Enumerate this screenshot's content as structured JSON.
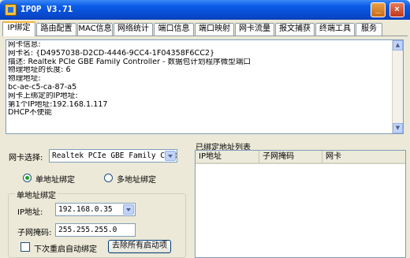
{
  "window": {
    "title": "IPOP V3.71"
  },
  "tabs": [
    {
      "label": "IP绑定"
    },
    {
      "label": "路由配置"
    },
    {
      "label": "MAC信息"
    },
    {
      "label": "网络统计"
    },
    {
      "label": "端口信息"
    },
    {
      "label": "端口映射"
    },
    {
      "label": "网卡流量"
    },
    {
      "label": "报文捕获"
    },
    {
      "label": "终端工具"
    },
    {
      "label": "服务"
    }
  ],
  "info": {
    "lines": [
      "网卡信息:",
      "网卡名: {D4957038-D2CD-4446-9CC4-1F04358F6CC2}",
      "描述: Realtek PCIe GBE Family Controller - 数据包计划程序微型端口",
      "物理地址的长度: 6",
      "物理地址:",
      "bc-ae-c5-ca-87-a5",
      "网卡上绑定的IP地址:",
      "第1个IP地址:192.168.1.117",
      "DHCP不使能"
    ]
  },
  "binding": {
    "nic_label": "网卡选择:",
    "nic_value": "Realtek PCIe GBE Family Cont",
    "mode_single": "单地址绑定",
    "mode_multi": "多地址绑定",
    "group_title": "单地址绑定",
    "ip_label": "IP地址:",
    "ip_value": "192.168.0.35",
    "mask_label": "子网掩码:",
    "mask_value": "255.255.255.0",
    "autostart_label": "下次重启自动绑定",
    "remove_button": "去除所有启动项"
  },
  "bound_list": {
    "title": "已绑定地址列表",
    "columns": [
      "IP地址",
      "子网掩码",
      "网卡"
    ]
  }
}
